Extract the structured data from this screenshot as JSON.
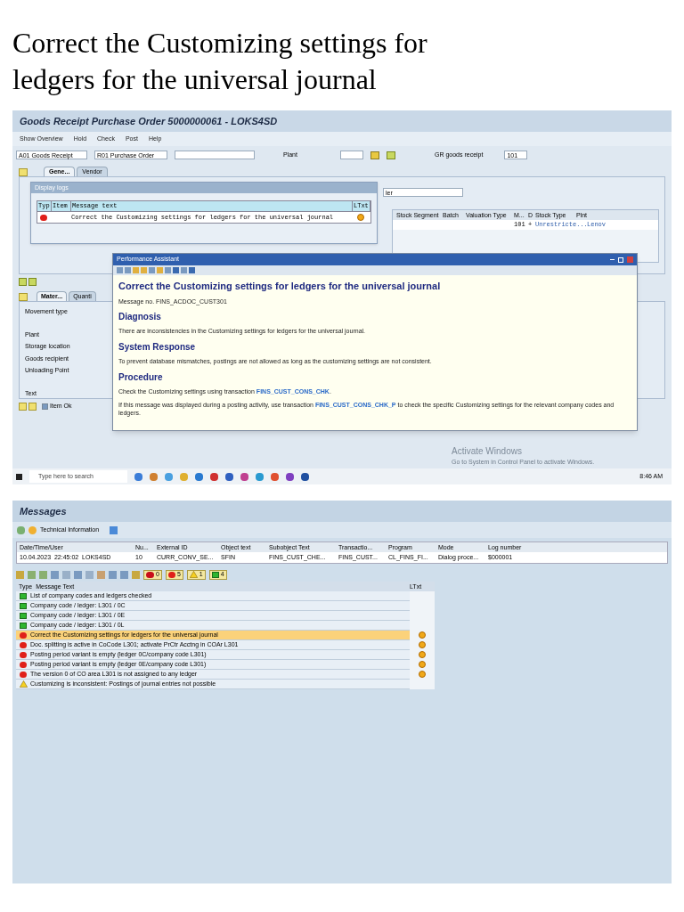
{
  "page_title": "Correct the Customizing settings for ledgers for the universal journal",
  "goods_receipt": {
    "window_title": "Goods Receipt Purchase Order 5000000061 - LOKS4SD",
    "toolbar": [
      "Show Overview",
      "Hold",
      "Check",
      "Post",
      "Help"
    ],
    "action_dropdown": "A01 Goods Receipt",
    "reference_dropdown": "R01 Purchase Order",
    "plant_label": "Plant",
    "gr_label": "GR goods receipt",
    "movement_field": "101",
    "header_tabs": [
      {
        "label": "Gene...",
        "selected": true
      },
      {
        "label": "Vendor",
        "selected": false
      }
    ],
    "vendor_field": "ler",
    "item_columns": [
      "Stock Segment",
      "Batch",
      "Valuation Type",
      "M...",
      "D",
      "Stock Type",
      "Plnt"
    ],
    "item_row": [
      "101",
      "+",
      "Unrestricte...",
      "Lenov"
    ],
    "detail_tabs": [
      {
        "label": "Mater...",
        "selected": true
      },
      {
        "label": "Quanti",
        "selected": false
      }
    ],
    "detail_labels": [
      "Movement type",
      "Plant",
      "Storage location",
      "Goods recipient",
      "Unloading Point",
      "Text"
    ],
    "item_ok": {
      "label": "Item Ok",
      "checked": true
    },
    "activation_notice": {
      "title": "Activate Windows",
      "detail": "Go to System in Control Panel to activate Windows."
    },
    "taskbar": {
      "search_placeholder": "Type here to search",
      "time": "8:46 AM"
    }
  },
  "display_logs": {
    "title": "Display logs",
    "columns": [
      "Typ",
      "Item",
      "Message text",
      "LTxt"
    ],
    "rows": [
      {
        "kind": "error",
        "message": "Correct the Customizing settings for ledgers for the universal journal"
      }
    ]
  },
  "performance_assistant": {
    "title": "Performance Assistant",
    "heading": "Correct the Customizing settings for ledgers for the universal journal",
    "message_no": "Message no. FINS_ACDOC_CUST301",
    "sections": [
      {
        "heading": "Diagnosis",
        "paragraphs": [
          {
            "before": "There are inconsistencies in the Customizing settings for ledgers for the universal journal."
          }
        ]
      },
      {
        "heading": "System Response",
        "paragraphs": [
          {
            "before": "To prevent database mismatches, postings are not allowed as long as the customizing settings are not consistent."
          }
        ]
      },
      {
        "heading": "Procedure",
        "paragraphs": [
          {
            "before": "Check the Customizing settings using transaction ",
            "link": "FINS_CUST_CONS_CHK",
            "after": "."
          },
          {
            "before": "If this message was displayed during a posting activity, use transaction ",
            "link": "FINS_CUST_CONS_CHK_P",
            "after": " to check the specific Customizing settings for the relevant company codes and ledgers."
          }
        ]
      }
    ]
  },
  "messages": {
    "title": "Messages",
    "toolbar_label": "Technical Information",
    "log_columns": [
      "Date/Time/User",
      "Nu...",
      "External ID",
      "Object text",
      "Subobject Text",
      "Transactio...",
      "Program",
      "Mode",
      "Log number"
    ],
    "log_row": [
      "10.04.2023  22:45:02  LOKS4SD",
      "10",
      "CURR_CONV_SE...",
      "SFIN",
      "FINS_CUST_CHE...",
      "FINS_CUST...",
      "CL_FINS_FI...",
      "Dialog proce...",
      "$000001"
    ],
    "counters": [
      {
        "kind": "stop",
        "count": "0"
      },
      {
        "kind": "error",
        "count": "5"
      },
      {
        "kind": "warning",
        "count": "1"
      },
      {
        "kind": "success",
        "count": "4"
      }
    ],
    "columns": [
      "Type",
      "Message Text",
      "LTxt"
    ],
    "rows": [
      {
        "kind": "success",
        "text": "List of company codes and ledgers checked",
        "long_text": false,
        "selected": false
      },
      {
        "kind": "success",
        "text": "Company code / ledger: L301 / 0C",
        "long_text": false,
        "selected": false
      },
      {
        "kind": "success",
        "text": "Company code / ledger: L301 / 0E",
        "long_text": false,
        "selected": false
      },
      {
        "kind": "success",
        "text": "Company code / ledger: L301 / 0L",
        "long_text": false,
        "selected": false
      },
      {
        "kind": "error",
        "text": "Correct the Customizing settings for ledgers for the universal journal",
        "long_text": true,
        "selected": true
      },
      {
        "kind": "error",
        "text": "Doc. splitting is active in CoCode L301; activate PrCtr Acctng in COAr L301",
        "long_text": true,
        "selected": false
      },
      {
        "kind": "error",
        "text": "Posting period variant is empty (ledger 0C/company code L301)",
        "long_text": true,
        "selected": false
      },
      {
        "kind": "error",
        "text": "Posting period variant is empty (ledger 0E/company code L301)",
        "long_text": true,
        "selected": false
      },
      {
        "kind": "error",
        "text": "The version 0 of CO area L301 is not assigned to any ledger",
        "long_text": true,
        "selected": false
      },
      {
        "kind": "warning",
        "text": "Customizing is inconsistent: Postings of journal entries not possible",
        "long_text": false,
        "selected": false
      }
    ]
  }
}
